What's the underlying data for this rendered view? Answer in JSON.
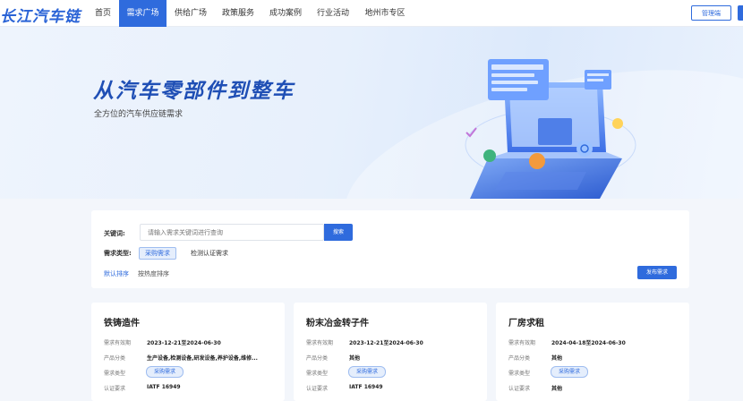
{
  "nav": {
    "logo": "长江汽车链",
    "items": [
      {
        "label": "首页",
        "active": false
      },
      {
        "label": "需求广场",
        "active": true
      },
      {
        "label": "供给广场",
        "active": false
      },
      {
        "label": "政策服务",
        "active": false
      },
      {
        "label": "成功案例",
        "active": false
      },
      {
        "label": "行业活动",
        "active": false
      },
      {
        "label": "地州市专区",
        "active": false
      }
    ],
    "login_label": "管理端"
  },
  "hero": {
    "title": "从汽车零部件到整车",
    "subtitle": "全方位的汽车供应链需求"
  },
  "search": {
    "keyword_label": "关键词:",
    "placeholder": "请输入需求关键词进行查询",
    "search_button": "搜索",
    "type_label": "需求类型:",
    "type_options": [
      "采购需求",
      "检测认证需求"
    ],
    "selected_type": "采购需求",
    "sort_default": "默认排序",
    "sort_hot": "按热度排序",
    "publish_button": "发布需求"
  },
  "cards": [
    {
      "title": "铁铸造件",
      "rows": [
        {
          "key": "需求有效期",
          "value": "2023-12-21至2024-06-30"
        },
        {
          "key": "产品分类",
          "value": "生产设备,检测设备,研发设备,养护设备,维修..."
        },
        {
          "key": "需求类型",
          "value": "采购需求"
        },
        {
          "key": "认证要求",
          "value": "IATF 16949"
        }
      ]
    },
    {
      "title": "粉末冶金转子件",
      "rows": [
        {
          "key": "需求有效期",
          "value": "2023-12-21至2024-06-30"
        },
        {
          "key": "产品分类",
          "value": "其他"
        },
        {
          "key": "需求类型",
          "value": "采购需求"
        },
        {
          "key": "认证要求",
          "value": "IATF 16949"
        }
      ]
    },
    {
      "title": "厂房求租",
      "rows": [
        {
          "key": "需求有效期",
          "value": "2024-04-18至2024-06-30"
        },
        {
          "key": "产品分类",
          "value": "其他"
        },
        {
          "key": "需求类型",
          "value": "采购需求"
        },
        {
          "key": "认证要求",
          "value": "其他"
        }
      ]
    }
  ]
}
